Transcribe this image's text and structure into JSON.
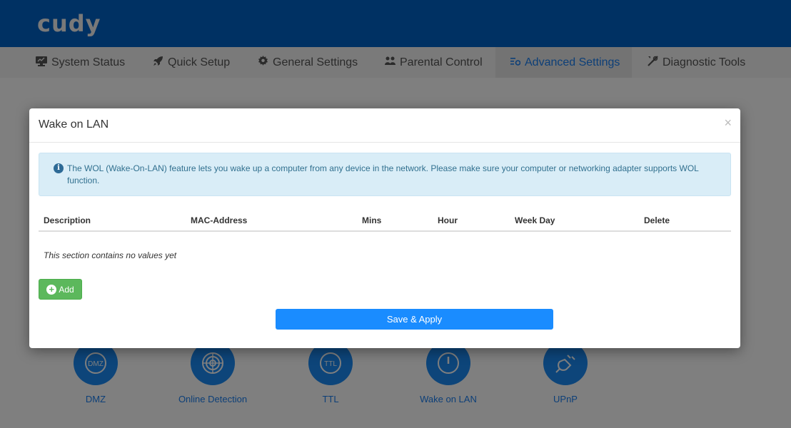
{
  "header": {
    "logo": "cudy"
  },
  "nav": {
    "items": [
      {
        "label": "System Status",
        "icon": "monitor-icon"
      },
      {
        "label": "Quick Setup",
        "icon": "rocket-icon"
      },
      {
        "label": "General Settings",
        "icon": "gear-icon"
      },
      {
        "label": "Parental Control",
        "icon": "users-icon"
      },
      {
        "label": "Advanced Settings",
        "icon": "advanced-settings-icon",
        "active": true
      },
      {
        "label": "Diagnostic Tools",
        "icon": "tools-icon"
      }
    ]
  },
  "features": [
    {
      "label": "DMZ",
      "icon": "dmz-icon",
      "icon_text": "DMZ"
    },
    {
      "label": "Online Detection",
      "icon": "radar-icon"
    },
    {
      "label": "TTL",
      "icon": "ttl-icon",
      "icon_text": "TTL"
    },
    {
      "label": "Wake on LAN",
      "icon": "power-icon"
    },
    {
      "label": "UPnP",
      "icon": "plug-icon"
    }
  ],
  "modal": {
    "title": "Wake on LAN",
    "close": "×",
    "info": "The WOL (Wake-On-LAN) feature lets you wake up a computer from any device in the network. Please make sure your computer or networking adapter supports WOL function.",
    "columns": [
      "Description",
      "MAC-Address",
      "Mins",
      "Hour",
      "Week Day",
      "Delete"
    ],
    "empty_text": "This section contains no values yet",
    "add_label": "Add",
    "save_label": "Save & Apply"
  },
  "colors": {
    "brand": "#0063c6",
    "accent": "#1a8cff",
    "add_button": "#5cb85c",
    "info_bg": "#d9edf7"
  }
}
